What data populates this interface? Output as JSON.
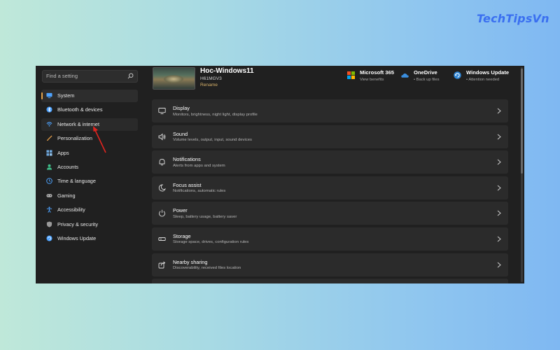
{
  "watermark": "TechTipsVn",
  "search": {
    "placeholder": "Find a setting"
  },
  "sidebar": {
    "items": [
      {
        "label": "System",
        "icon": "monitor-icon",
        "color": "#4da3ff"
      },
      {
        "label": "Bluetooth & devices",
        "icon": "bluetooth-icon",
        "color": "#4da3ff"
      },
      {
        "label": "Network & internet",
        "icon": "wifi-icon",
        "color": "#4da3ff"
      },
      {
        "label": "Personalization",
        "icon": "brush-icon",
        "color": "#e8a04a"
      },
      {
        "label": "Apps",
        "icon": "apps-icon",
        "color": "#6fa8dc"
      },
      {
        "label": "Accounts",
        "icon": "person-icon",
        "color": "#3fbf8a"
      },
      {
        "label": "Time & language",
        "icon": "globe-clock-icon",
        "color": "#4da3ff"
      },
      {
        "label": "Gaming",
        "icon": "gamepad-icon",
        "color": "#b0b0b0"
      },
      {
        "label": "Accessibility",
        "icon": "accessibility-icon",
        "color": "#4da3ff"
      },
      {
        "label": "Privacy & security",
        "icon": "shield-icon",
        "color": "#9a9a9a"
      },
      {
        "label": "Windows Update",
        "icon": "update-icon",
        "color": "#4da3ff"
      }
    ]
  },
  "device": {
    "name": "Hoc-Windows11",
    "model": "H61MGV3",
    "rename": "Rename"
  },
  "header_items": [
    {
      "title": "Microsoft 365",
      "sub": "View benefits",
      "icon": "microsoft-365-icon"
    },
    {
      "title": "OneDrive",
      "sub": "• Back up files",
      "icon": "onedrive-icon"
    },
    {
      "title": "Windows Update",
      "sub": "• Attention needed",
      "icon": "windows-update-icon"
    }
  ],
  "cards": [
    {
      "title": "Display",
      "sub": "Monitors, brightness, night light, display profile",
      "icon": "display-icon"
    },
    {
      "title": "Sound",
      "sub": "Volume levels, output, input, sound devices",
      "icon": "speaker-icon"
    },
    {
      "title": "Notifications",
      "sub": "Alerts from apps and system",
      "icon": "bell-icon"
    },
    {
      "title": "Focus assist",
      "sub": "Notifications, automatic rules",
      "icon": "moon-icon"
    },
    {
      "title": "Power",
      "sub": "Sleep, battery usage, battery saver",
      "icon": "power-icon"
    },
    {
      "title": "Storage",
      "sub": "Storage space, drives, configuration rules",
      "icon": "storage-icon"
    },
    {
      "title": "Nearby sharing",
      "sub": "Discoverability, received files location",
      "icon": "share-icon"
    }
  ]
}
